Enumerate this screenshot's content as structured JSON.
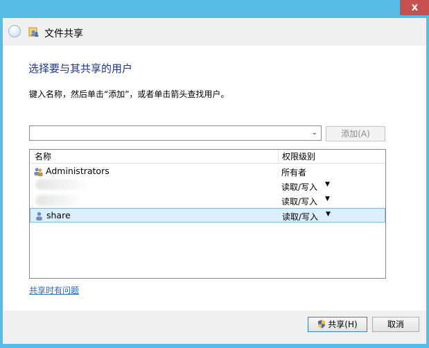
{
  "window": {
    "title": "文件共享",
    "close_label": "x"
  },
  "main": {
    "heading": "选择要与其共享的用户",
    "instruction": "键入名称，然后单击“添加”，或者单击箭头查找用户。",
    "name_input": {
      "value": "",
      "placeholder": ""
    },
    "add_button": "添加(A)"
  },
  "list": {
    "columns": [
      "名称",
      "权限级别"
    ],
    "rows": [
      {
        "name": "Administrators",
        "permission": "所有者",
        "icon": "user-group-icon",
        "selected": false
      },
      {
        "name": "",
        "permission": "读取/写入",
        "icon": "user-icon",
        "selected": false,
        "obscured": true
      },
      {
        "name": "",
        "permission": "读取/写入",
        "icon": "user-icon",
        "selected": false,
        "obscured": true
      },
      {
        "name": "share",
        "permission": "读取/写入",
        "icon": "user-icon",
        "selected": true
      }
    ]
  },
  "footer": {
    "help_link": "共享时有问题",
    "share_button": "共享(H)",
    "cancel_button": "取消"
  },
  "colors": {
    "frame": "#57bde4",
    "close": "#c74f4f",
    "heading": "#1e3287",
    "link": "#2266cc",
    "selection": "#dceefc"
  }
}
